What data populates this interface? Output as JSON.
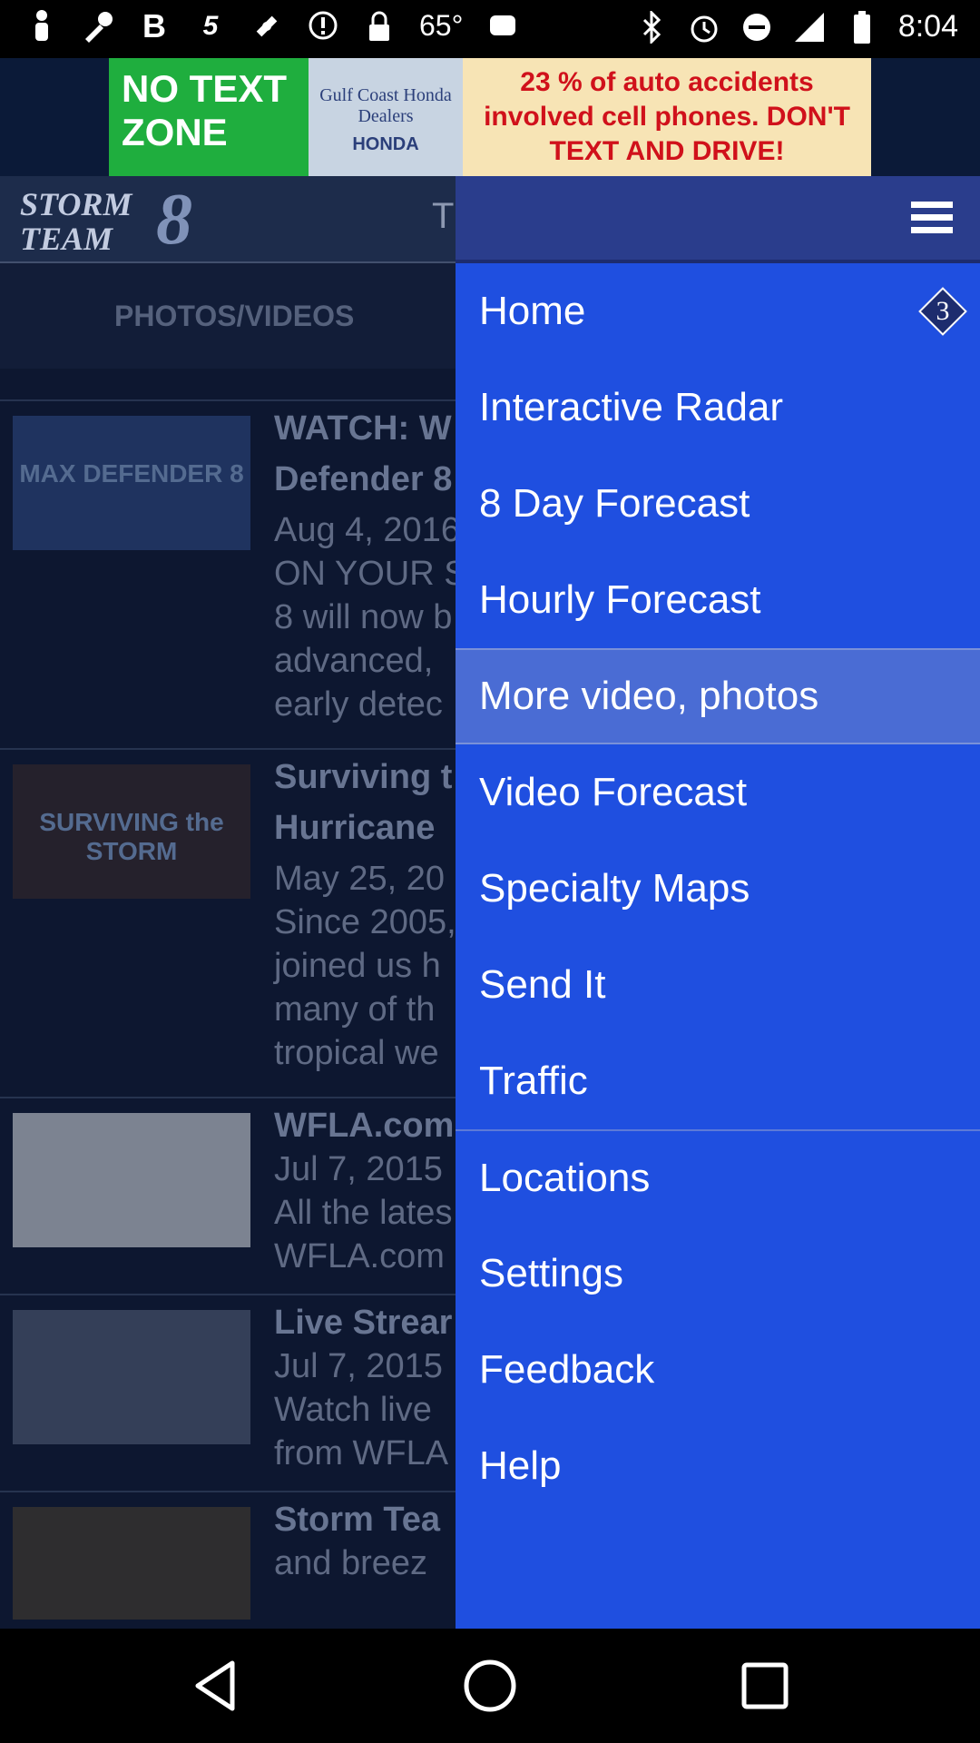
{
  "status_bar": {
    "temperature": "65°",
    "time": "8:04",
    "left_icons": [
      "person-icon",
      "wrench-icon",
      "bold-b-icon",
      "sprint-icon",
      "satellite-icon",
      "alert-icon",
      "lock-icon"
    ],
    "right_icons": [
      "bluetooth-icon",
      "alarm-icon",
      "do-not-disturb-icon",
      "signal-icon",
      "battery-icon"
    ]
  },
  "ad": {
    "left_text": "NO TEXT ZONE",
    "middle_text": "Gulf Coast Honda Dealers",
    "brand": "HONDA",
    "right_text": "23 % of auto accidents involved cell phones. DON'T TEXT AND DRIVE!"
  },
  "app": {
    "logo_text": "STORM TEAM",
    "logo_number": "8",
    "header_text": "T",
    "tab_label": "PHOTOS/VIDEOS",
    "feed": [
      {
        "thumb": "MAX DEFENDER 8",
        "lines": [
          "WATCH: W",
          "Defender 8",
          "Aug 4, 2016",
          "ON YOUR S",
          "8 will now b",
          "advanced,",
          "early detec"
        ]
      },
      {
        "thumb": "SURVIVING the STORM",
        "lines": [
          "Surviving t",
          "Hurricane",
          "May 25, 20",
          "Since 2005,",
          "joined us h",
          "many of th",
          "tropical we"
        ]
      },
      {
        "thumb": "",
        "lines": [
          "WFLA.com",
          "Jul 7, 2015",
          "All the lates",
          "WFLA.com"
        ]
      },
      {
        "thumb": "",
        "lines": [
          "Live Strear",
          "Jul 7, 2015",
          "Watch live",
          "from WFLA"
        ]
      },
      {
        "thumb": "",
        "lines": [
          "Storm Tea",
          "and breez"
        ]
      }
    ]
  },
  "menu": {
    "items": [
      {
        "label": "Home",
        "badge": "3"
      },
      {
        "label": "Interactive Radar"
      },
      {
        "label": "8 Day Forecast"
      },
      {
        "label": "Hourly Forecast"
      },
      {
        "label": "More video, photos"
      },
      {
        "label": "Video Forecast"
      },
      {
        "label": "Specialty Maps"
      },
      {
        "label": "Send It"
      },
      {
        "label": "Traffic"
      },
      {
        "label": "Locations"
      },
      {
        "label": "Settings"
      },
      {
        "label": "Feedback"
      },
      {
        "label": "Help"
      }
    ]
  },
  "colors": {
    "menu_bg": "#1f4fe0",
    "menu_active": "#4a6cd4",
    "app_bg": "#0d1730"
  }
}
